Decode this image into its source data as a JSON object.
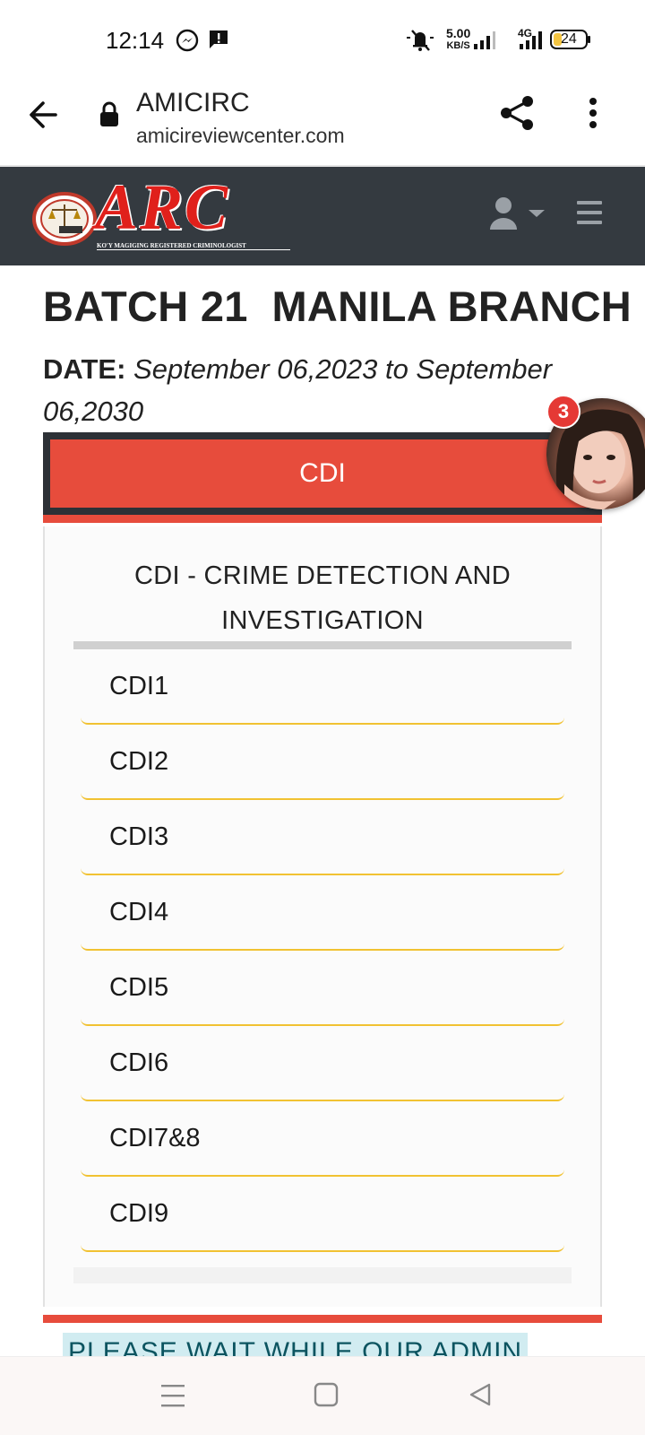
{
  "status_bar": {
    "time": "12:14",
    "net_speed_value": "5.00",
    "net_speed_unit": "KB/S",
    "network_type": "4G",
    "battery": "24"
  },
  "browser": {
    "title": "AMICIRC",
    "url": "amicireviewcenter.com"
  },
  "header": {
    "logo_text": "ARC",
    "logo_tagline": "KO'Y MAGIGING REGISTERED CRIMINOLOGIST"
  },
  "main": {
    "batch_title": "BATCH 21  MANILA BRANCH",
    "date_label": "DATE:",
    "date_value": " September 06,2023 to September 06,2030",
    "subject_button": "CDI",
    "panel_title": "CDI - CRIME DETECTION AND INVESTIGATION",
    "items": [
      {
        "label": "CDI1"
      },
      {
        "label": "CDI2"
      },
      {
        "label": "CDI3"
      },
      {
        "label": "CDI4"
      },
      {
        "label": "CDI5"
      },
      {
        "label": "CDI6"
      },
      {
        "label": "CDI7&8"
      },
      {
        "label": "CDI9"
      }
    ],
    "notice": "PLEASE WAIT WHILE OUR ADMIN"
  },
  "chat_head": {
    "badge_count": "3"
  },
  "colors": {
    "header_bg": "#343a40",
    "accent_red": "#e74c3c",
    "item_underline": "#f1c232",
    "notice_bg": "#d1ecf1",
    "notice_text": "#0c5460"
  }
}
